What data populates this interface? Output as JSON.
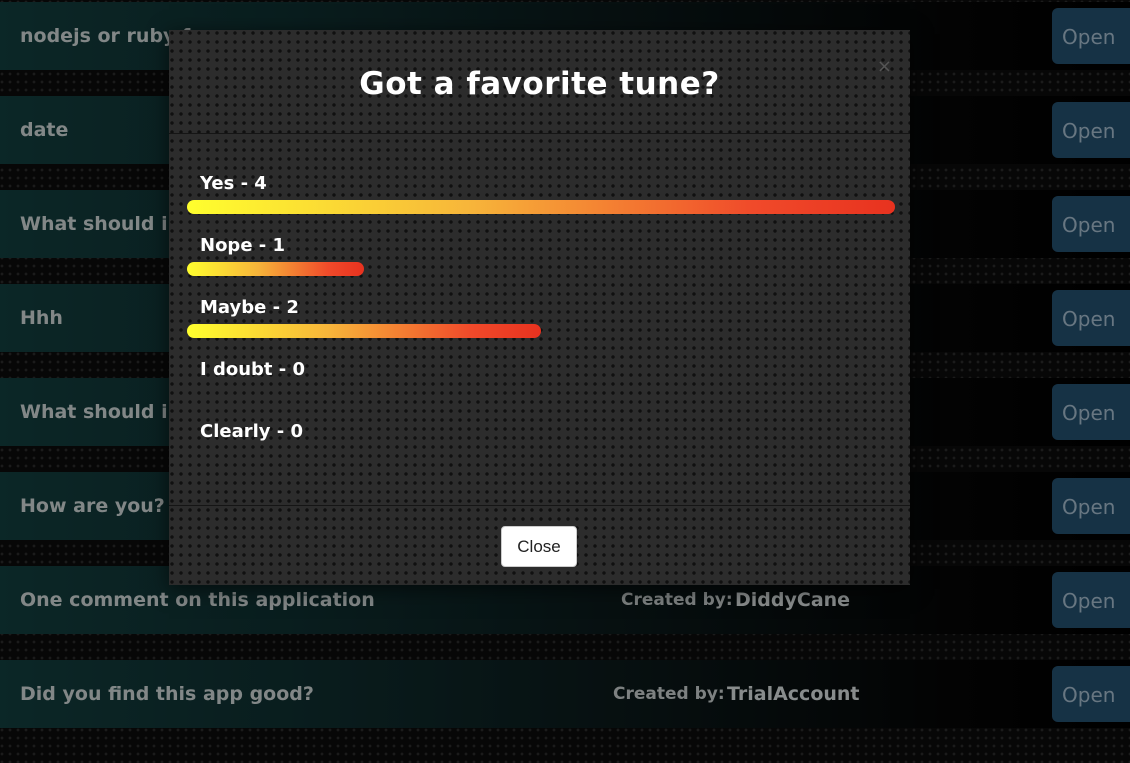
{
  "polls": [
    {
      "question": "nodejs or ruby f",
      "created_label": "",
      "user": "",
      "open_label": "Open"
    },
    {
      "question": "date",
      "created_label": "",
      "user": "",
      "open_label": "Open"
    },
    {
      "question": "What should i ea",
      "created_label": "",
      "user": "",
      "open_label": "Open"
    },
    {
      "question": "Hhh",
      "created_label": "",
      "user": "",
      "open_label": "Open"
    },
    {
      "question": "What should i w",
      "created_label": "",
      "user": "",
      "open_label": "Open"
    },
    {
      "question": "How are you?",
      "created_label": "",
      "user": "",
      "open_label": "Open"
    },
    {
      "question": "One comment on this application",
      "created_label": "Created by:",
      "user": "DiddyCane",
      "open_label": "Open"
    },
    {
      "question": "Did you find this app good?",
      "created_label": "Created by:",
      "user": "TrialAccount",
      "open_label": "Open"
    }
  ],
  "modal": {
    "title": "Got a favorite tune?",
    "close_x": "×",
    "close_label": "Close",
    "options": [
      {
        "label": "Yes - 4",
        "votes": 4,
        "fraction": 1.0
      },
      {
        "label": "Nope - 1",
        "votes": 1,
        "fraction": 0.25
      },
      {
        "label": "Maybe - 2",
        "votes": 2,
        "fraction": 0.5
      },
      {
        "label": "I doubt - 0",
        "votes": 0,
        "fraction": 0
      },
      {
        "label": "Clearly - 0",
        "votes": 0,
        "fraction": 0
      }
    ]
  },
  "colors": {
    "bar_start": "#ffff2e",
    "bar_end": "#e8321f",
    "open_button": "#234d6b"
  }
}
